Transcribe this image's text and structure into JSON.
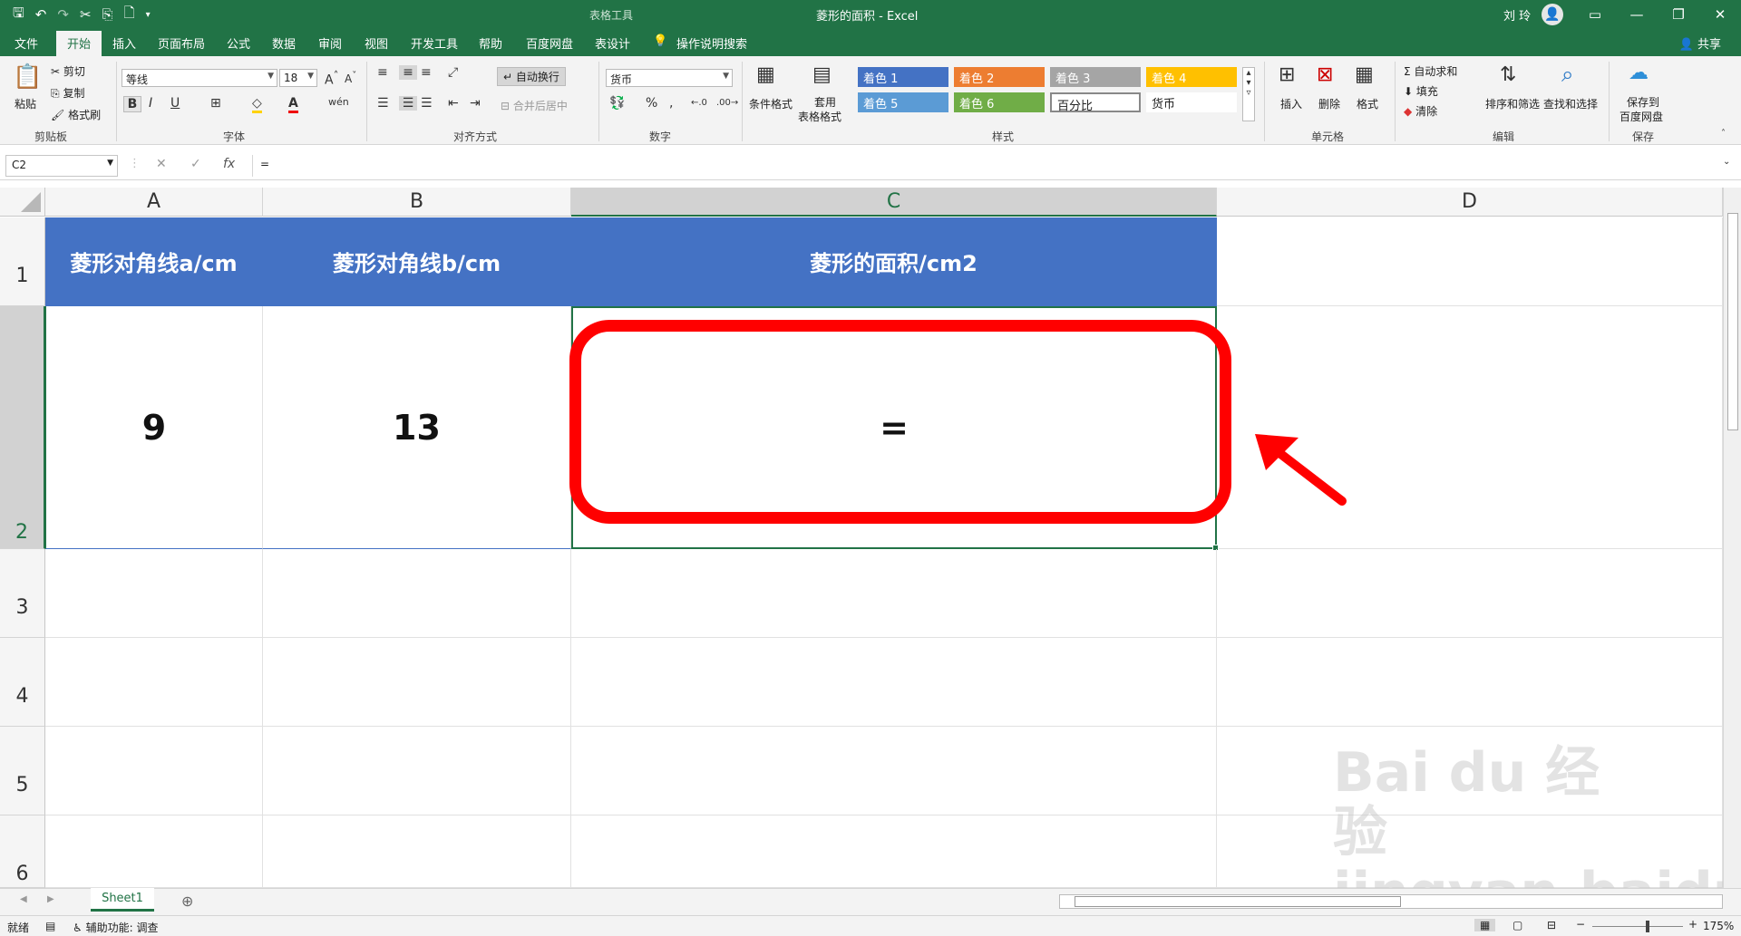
{
  "title_bar": {
    "context_label": "表格工具",
    "document_title": "菱形的面积  -  Excel",
    "user_name": "刘 玲",
    "avatar_initial": "👤"
  },
  "tabs": [
    "文件",
    "开始",
    "插入",
    "页面布局",
    "公式",
    "数据",
    "审阅",
    "视图",
    "开发工具",
    "帮助",
    "百度网盘",
    "表设计"
  ],
  "active_tab": "开始",
  "tell_me": "操作说明搜索",
  "share_label": "共享",
  "ribbon": {
    "clipboard": {
      "paste": "粘贴",
      "cut": "剪切",
      "copy": "复制",
      "format_painter": "格式刷",
      "group": "剪贴板"
    },
    "font": {
      "name": "等线",
      "size": "18",
      "group": "字体"
    },
    "alignment": {
      "wrap": "自动换行",
      "merge": "合并后居中",
      "group": "对齐方式"
    },
    "number": {
      "format": "货币",
      "group": "数字"
    },
    "styles": {
      "cond_format": "条件格式",
      "table_format_1": "套用",
      "table_format_2": "表格格式",
      "cells": [
        "着色 1",
        "着色 2",
        "着色 3",
        "着色 4",
        "着色 5",
        "着色 6",
        "百分比",
        "货币"
      ],
      "group": "样式"
    },
    "cells_group": {
      "insert": "插入",
      "delete": "删除",
      "format": "格式",
      "group": "单元格"
    },
    "editing": {
      "autosum": "自动求和",
      "fill": "填充",
      "clear": "清除",
      "sort": "排序和筛选",
      "find": "查找和选择",
      "group": "编辑"
    },
    "save": {
      "label_1": "保存到",
      "label_2": "百度网盘",
      "group": "保存"
    }
  },
  "formula_bar": {
    "name_box": "C2",
    "formula": "="
  },
  "columns": [
    "A",
    "B",
    "C",
    "D"
  ],
  "rows": [
    "1",
    "2",
    "3",
    "4",
    "5",
    "6"
  ],
  "cells": {
    "A1": "菱形对角线a/cm",
    "B1": "菱形对角线b/cm",
    "C1": "菱形的面积/cm2",
    "A2": "9",
    "B2": "13",
    "C2": "="
  },
  "sheet_tab": "Sheet1",
  "status": {
    "ready": "就绪",
    "accessibility": "辅助功能: 调查",
    "zoom": "175%"
  },
  "watermark": "Bai du 经验  jingyan.baidu.com",
  "colors": {
    "excel_green": "#217346",
    "header_fill": "#4472c4",
    "annotation_red": "#ff0000"
  }
}
